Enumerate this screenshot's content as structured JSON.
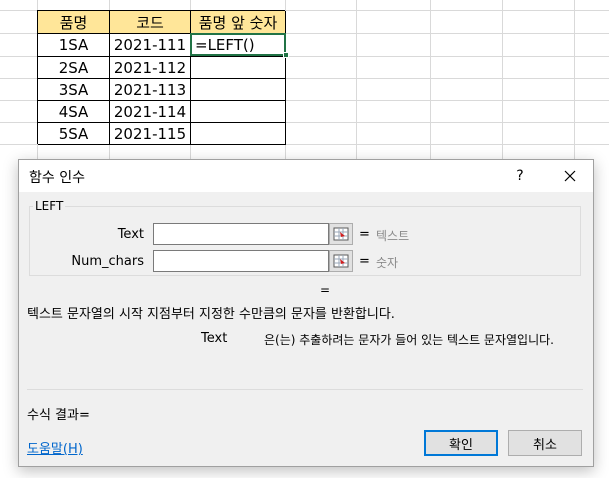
{
  "sheet": {
    "headers": [
      "품명",
      "코드",
      "품명 앞 숫자"
    ],
    "rows": [
      [
        "1SA",
        "2021-111",
        "=LEFT()"
      ],
      [
        "2SA",
        "2021-112",
        ""
      ],
      [
        "3SA",
        "2021-113",
        ""
      ],
      [
        "4SA",
        "2021-114",
        ""
      ],
      [
        "5SA",
        "2021-115",
        ""
      ]
    ],
    "header_color": "#ffe699",
    "active_cell_color": "#217346"
  },
  "dialog": {
    "title": "함수 인수",
    "help_glyph": "?",
    "function_name": "LEFT",
    "args": [
      {
        "label": "Text",
        "value": "",
        "equals": "=",
        "type_hint": "텍스트"
      },
      {
        "label": "Num_chars",
        "value": "",
        "equals": "=",
        "type_hint": "숫자"
      }
    ],
    "result_equals": "=",
    "description": "텍스트 문자열의 시작 지점부터 지정한 수만큼의 문자를 반환합니다.",
    "arg_desc_name": "Text",
    "arg_desc_text": "은(는) 추출하려는 문자가 들어 있는 텍스트 문자열입니다.",
    "formula_result_label": "수식 결과=",
    "help_link": "도움말(H)",
    "ok_label": "확인",
    "cancel_label": "취소",
    "accent_color": "#0078d7"
  }
}
